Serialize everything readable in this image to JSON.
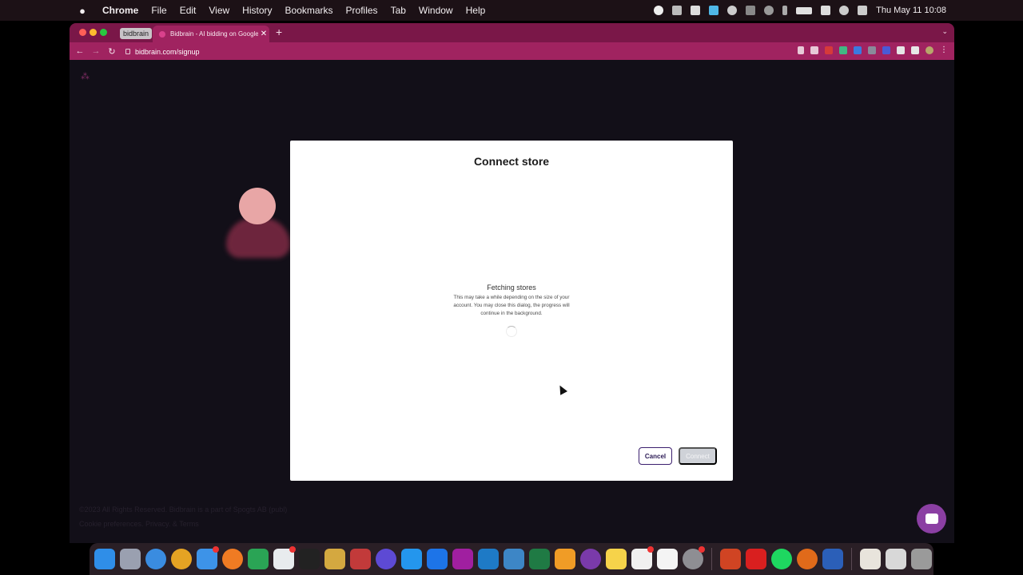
{
  "menubar": {
    "apple": "",
    "app": "Chrome",
    "items": [
      "File",
      "Edit",
      "View",
      "History",
      "Bookmarks",
      "Profiles",
      "Tab",
      "Window",
      "Help"
    ],
    "clock": "Thu May 11  10:08"
  },
  "browser": {
    "tab_group": "bidbrain",
    "active_tab": "Bidbrain - AI bidding on Google",
    "new_tab": "+",
    "url": "bidbrain.com/signup"
  },
  "page": {
    "footer_line1": "©2023 All Rights Reserved. Bidbrain is a part of Spogts AB (publ)",
    "footer_line2": "Cookie preferences. Privacy. & Terms"
  },
  "modal": {
    "title": "Connect store",
    "status_title": "Fetching stores",
    "status_desc": "This may take a while depending on the size of your account. You may close this dialog, the progress will continue in the background.",
    "cancel_label": "Cancel",
    "connect_label": "Connect"
  },
  "colors": {
    "accent": "#a02360",
    "tabbar": "#7a1748",
    "page_bg": "#120f18",
    "primary_outline": "#3b1f6e",
    "disabled": "#cfd2d8",
    "chat": "#8b3fa3"
  },
  "dock": {
    "icons": [
      "finder-icon",
      "launchpad-icon",
      "safari-icon",
      "chrome-icon",
      "mail-icon",
      "ovpn-icon",
      "drive-icon",
      "slack-icon",
      "terminal-icon",
      "sequel-icon",
      "db-icon",
      "arc-icon",
      "docker-icon",
      "calendar-icon",
      "phpstorm-icon",
      "vscode-icon",
      "xcode-icon",
      "excel-icon",
      "sublime-icon",
      "github-icon",
      "notes-icon",
      "calendar2-icon",
      "reminders-icon",
      "settings-icon",
      "powerpoint-icon",
      "acrobat-icon",
      "spotify-icon",
      "firefox-icon",
      "word-icon",
      "document-icon",
      "file-icon",
      "trash-icon"
    ]
  }
}
